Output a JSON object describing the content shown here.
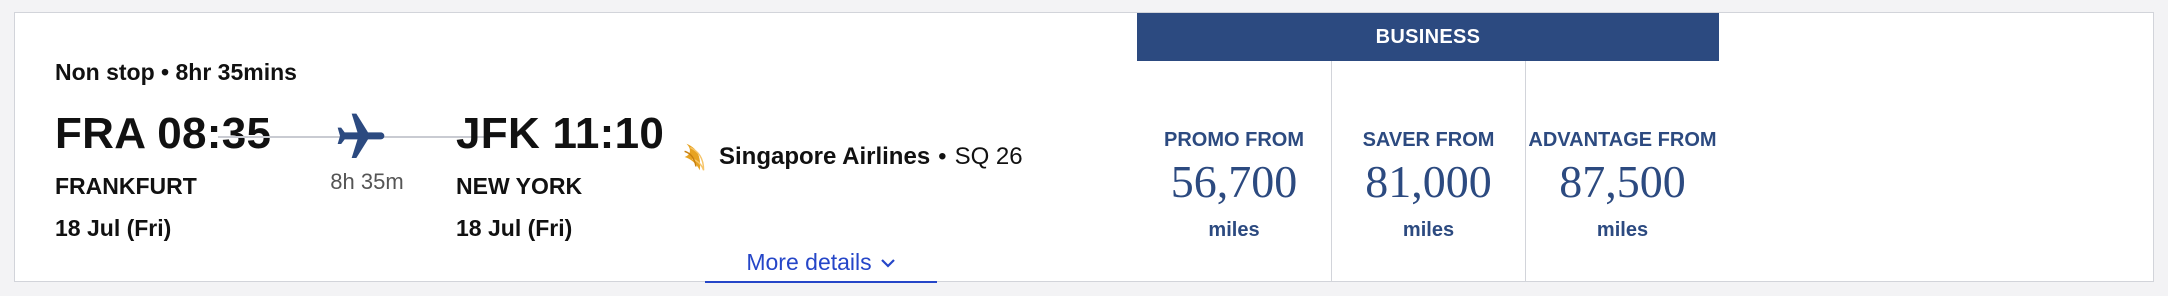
{
  "flight": {
    "summary": "Non stop • 8hr 35mins",
    "departure": {
      "code_time": "FRA 08:35",
      "city": "FRANKFURT",
      "date": "18 Jul (Fri)"
    },
    "arrival": {
      "code_time": "JFK 11:10",
      "city": "NEW YORK",
      "date": "18 Jul (Fri)"
    },
    "duration": "8h 35m",
    "airline": {
      "name": "Singapore Airlines",
      "separator": "•",
      "flight_number": "SQ 26"
    },
    "more_details_label": "More details"
  },
  "cabin": {
    "name": "BUSINESS",
    "fares": [
      {
        "label": "PROMO FROM",
        "amount": "56,700",
        "unit": "miles"
      },
      {
        "label": "SAVER FROM",
        "amount": "81,000",
        "unit": "miles"
      },
      {
        "label": "ADVANTAGE FROM",
        "amount": "87,500",
        "unit": "miles"
      }
    ]
  },
  "colors": {
    "brand_navy": "#2c4a80",
    "link_blue": "#2546c8",
    "logo_gold": "#e7a322"
  },
  "icons": {
    "plane": "airplane-icon",
    "airline_logo": "singapore-airlines-logo",
    "chevron": "chevron-down-icon"
  }
}
